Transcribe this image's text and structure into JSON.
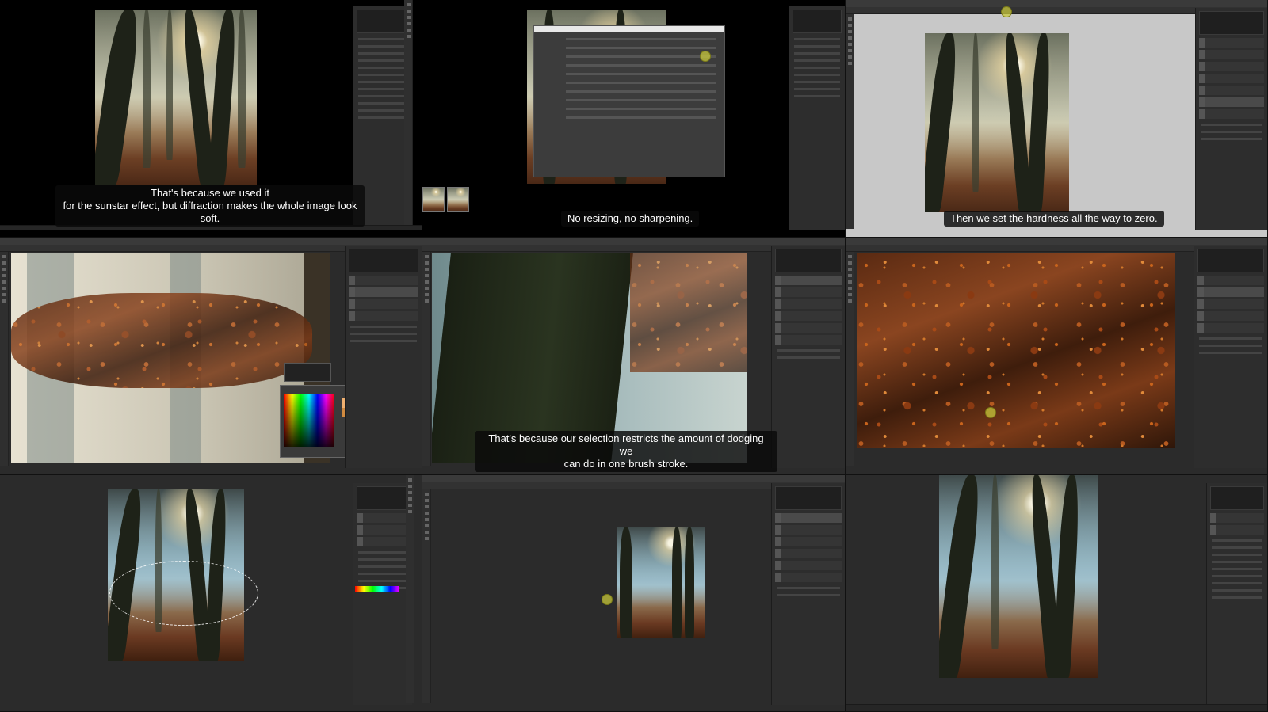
{
  "panels": [
    {
      "id": "p1",
      "subtitle": "That's because we used it\nfor the sunstar effect, but diffraction makes the whole image look\nsoft."
    },
    {
      "id": "p2",
      "subtitle": "No resizing, no sharpening."
    },
    {
      "id": "p3",
      "subtitle": "Then we set the hardness all the way to zero."
    },
    {
      "id": "p4",
      "subtitle": ""
    },
    {
      "id": "p5",
      "subtitle": "That's because our selection restricts the amount of dodging we\ncan do in one brush stroke."
    },
    {
      "id": "p6",
      "subtitle": ""
    },
    {
      "id": "p7",
      "subtitle": ""
    },
    {
      "id": "p8",
      "subtitle": ""
    },
    {
      "id": "p9",
      "subtitle": ""
    }
  ],
  "colors": {
    "app_bg": "#2b2b2b",
    "panel_bg": "#2d2d2d",
    "subtitle_bg": "#0a0a0a",
    "subtitle_text": "#ffffff",
    "cursor": "#c8c83c",
    "autumn_orange": "#d2782a"
  },
  "icons": [
    "tool-icon",
    "cursor-indicator-icon"
  ]
}
